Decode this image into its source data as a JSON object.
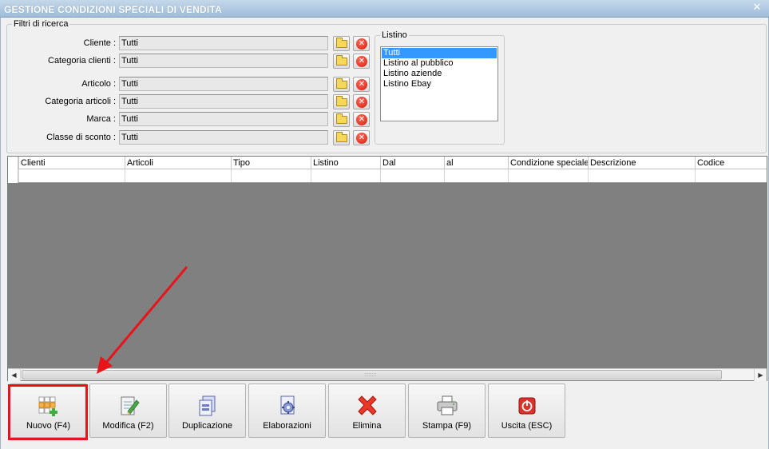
{
  "window": {
    "title": "GESTIONE CONDIZIONI SPECIALI DI VENDITA",
    "close_icon": "close-icon"
  },
  "filters": {
    "legend": "Filtri di ricerca",
    "rows": [
      {
        "label": "Cliente :",
        "value": "Tutti"
      },
      {
        "label": "Categoria clienti :",
        "value": "Tutti"
      },
      {
        "label": "Articolo :",
        "value": "Tutti"
      },
      {
        "label": "Categoria articoli :",
        "value": "Tutti"
      },
      {
        "label": "Marca :",
        "value": "Tutti"
      },
      {
        "label": "Classe di sconto :",
        "value": "Tutti"
      }
    ]
  },
  "listino": {
    "legend": "Listino",
    "items": [
      "Tutti",
      "Listino al pubblico",
      "Listino aziende",
      "Listino Ebay"
    ],
    "selected": "Tutti"
  },
  "grid": {
    "columns": [
      "Clienti",
      "Articoli",
      "Tipo",
      "Listino",
      "Dal",
      "al",
      "Condizione speciale",
      "Descrizione",
      "Codice"
    ],
    "scroll_grip": "::::::::"
  },
  "buttons": [
    {
      "label": "Nuovo (F4)",
      "icon": "new-grid-icon"
    },
    {
      "label": "Modifica (F2)",
      "icon": "edit-document-icon"
    },
    {
      "label": "Duplicazione",
      "icon": "duplicate-icon"
    },
    {
      "label": "Elaborazioni",
      "icon": "processing-gear-icon"
    },
    {
      "label": "Elimina",
      "icon": "delete-x-icon"
    },
    {
      "label": "Stampa (F9)",
      "icon": "printer-icon"
    },
    {
      "label": "Uscita (ESC)",
      "icon": "power-icon"
    }
  ],
  "annotation": {
    "highlight_color": "#e8141b",
    "target": "Nuovo (F4)"
  },
  "colors": {
    "titlebar": "#9fbcda",
    "grid_bg": "#808080",
    "selection": "#3399ff"
  }
}
